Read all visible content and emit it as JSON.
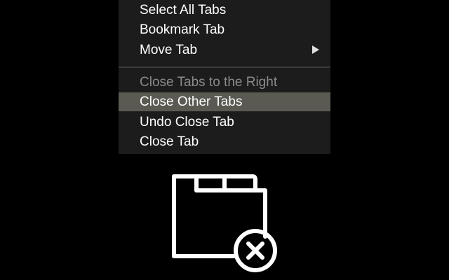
{
  "context_menu": {
    "items": [
      {
        "label": "Select All Tabs",
        "state": "normal"
      },
      {
        "label": "Bookmark Tab",
        "state": "normal"
      },
      {
        "label": "Move Tab",
        "state": "normal",
        "has_submenu": true
      },
      {
        "label": "Close Tabs to the Right",
        "state": "disabled"
      },
      {
        "label": "Close Other Tabs",
        "state": "highlighted"
      },
      {
        "label": "Undo Close Tab",
        "state": "normal"
      },
      {
        "label": "Close Tab",
        "state": "normal"
      }
    ],
    "colors": {
      "background": "#1c1c1c",
      "text": "#ffffff",
      "disabled_text": "#8a8a8a",
      "highlight": "#5a5a53"
    }
  },
  "illustration": {
    "icon": "close-other-tabs-icon",
    "color": "#ffffff"
  }
}
